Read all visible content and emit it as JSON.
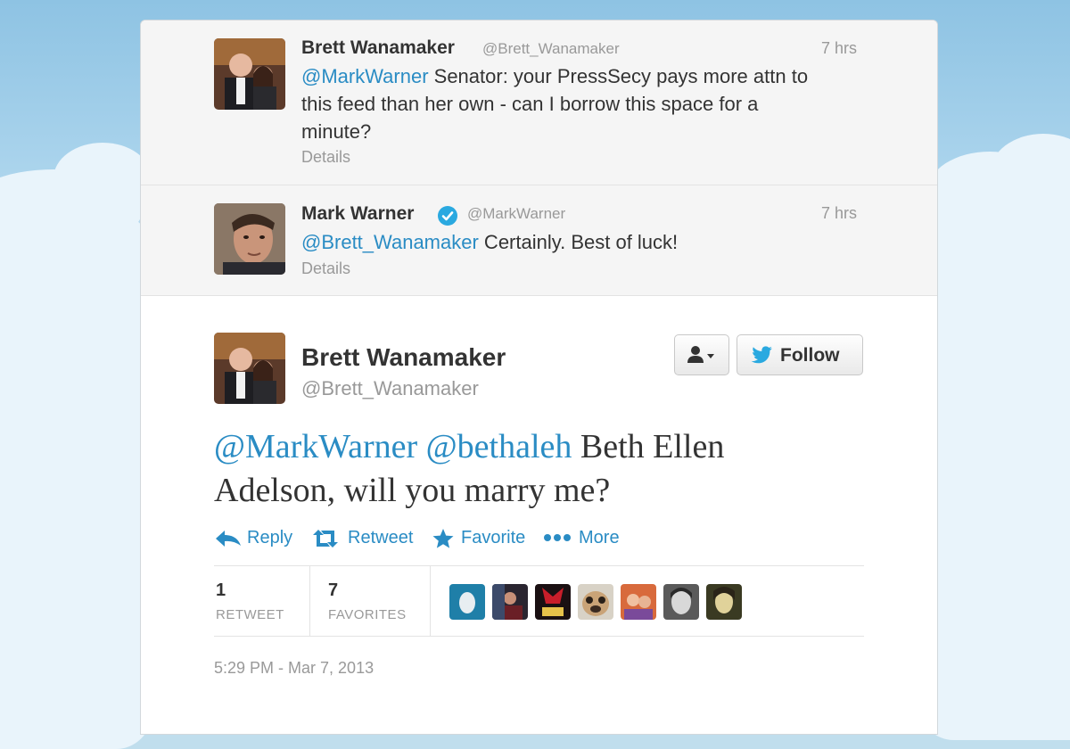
{
  "conversation": [
    {
      "name": "Brett Wanamaker",
      "handle": "@Brett_Wanamaker",
      "time": "7 hrs",
      "mention": "@MarkWarner",
      "text_line1_rest": " Senator: your PressSecy pays more attn to",
      "text_line2": "this feed than her own - can I borrow this space for a",
      "text_line3": "minute?",
      "details": "Details"
    },
    {
      "name": "Mark Warner",
      "handle": "@MarkWarner",
      "time": "7 hrs",
      "mention": "@Brett_Wanamaker",
      "text_rest": " Certainly. Best of luck!",
      "details": "Details",
      "verified": true
    }
  ],
  "main_tweet": {
    "name": "Brett Wanamaker",
    "handle": "@Brett_Wanamaker",
    "follow_label": "Follow",
    "mention1": "@MarkWarner",
    "mention2": "@bethaleh",
    "text_line1_rest": " Beth Ellen",
    "text_line2": "Adelson, will you marry me?",
    "actions": {
      "reply": "Reply",
      "retweet": "Retweet",
      "favorite": "Favorite",
      "more": "More"
    },
    "stats": {
      "retweets_count": "1",
      "retweets_label": "RETWEET",
      "favorites_count": "7",
      "favorites_label": "FAVORITES"
    },
    "timestamp": "5:29 PM - Mar 7, 2013"
  },
  "colors": {
    "link": "#2a8cc4",
    "twitter_bird": "#2aa9e0",
    "background": "#c0deed"
  },
  "icons": [
    "person-dropdown-icon",
    "twitter-bird-icon",
    "reply-arrow-icon",
    "retweet-icon",
    "star-icon",
    "more-dots-icon",
    "verified-badge-icon"
  ]
}
